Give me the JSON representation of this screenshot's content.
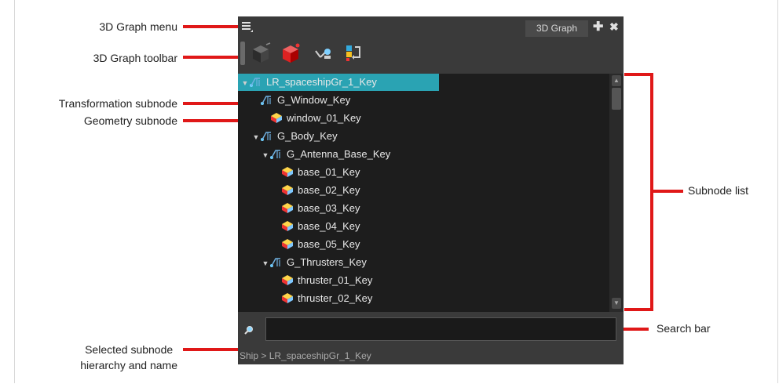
{
  "panel": {
    "tab_label": "3D Graph",
    "plus_glyph": "✚",
    "close_glyph": "✖",
    "breadcrumb": "Ship > LR_spaceshipGr_1_Key",
    "search_value": ""
  },
  "toolbar": {
    "buttons": [
      "cube-dark-icon",
      "cube-red-icon",
      "satellite-icon",
      "color-nodes-icon"
    ]
  },
  "tree": {
    "rows": [
      {
        "label": "LR_spaceshipGr_1_Key",
        "type": "transform",
        "expanded": true,
        "selected": true
      },
      {
        "label": "G_Window_Key",
        "type": "transform",
        "expanded": false
      },
      {
        "label": "window_01_Key",
        "type": "geometry"
      },
      {
        "label": "G_Body_Key",
        "type": "transform",
        "expanded": true
      },
      {
        "label": "G_Antenna_Base_Key",
        "type": "transform",
        "expanded": true
      },
      {
        "label": "base_01_Key",
        "type": "geometry"
      },
      {
        "label": "base_02_Key",
        "type": "geometry"
      },
      {
        "label": "base_03_Key",
        "type": "geometry"
      },
      {
        "label": "base_04_Key",
        "type": "geometry"
      },
      {
        "label": "base_05_Key",
        "type": "geometry"
      },
      {
        "label": "G_Thrusters_Key",
        "type": "transform",
        "expanded": true
      },
      {
        "label": "thruster_01_Key",
        "type": "geometry"
      },
      {
        "label": "thruster_02_Key",
        "type": "geometry"
      }
    ]
  },
  "annotations": {
    "menu": "3D Graph menu",
    "toolbar": "3D Graph toolbar",
    "transformation": "Transformation subnode",
    "geometry": "Geometry subnode",
    "subnode_list": "Subnode list",
    "search_bar": "Search bar",
    "selected_line1": "Selected subnode",
    "selected_line2": "hierarchy and name"
  },
  "colors": {
    "selection": "#2aa3b3",
    "callout": "#e01818"
  }
}
